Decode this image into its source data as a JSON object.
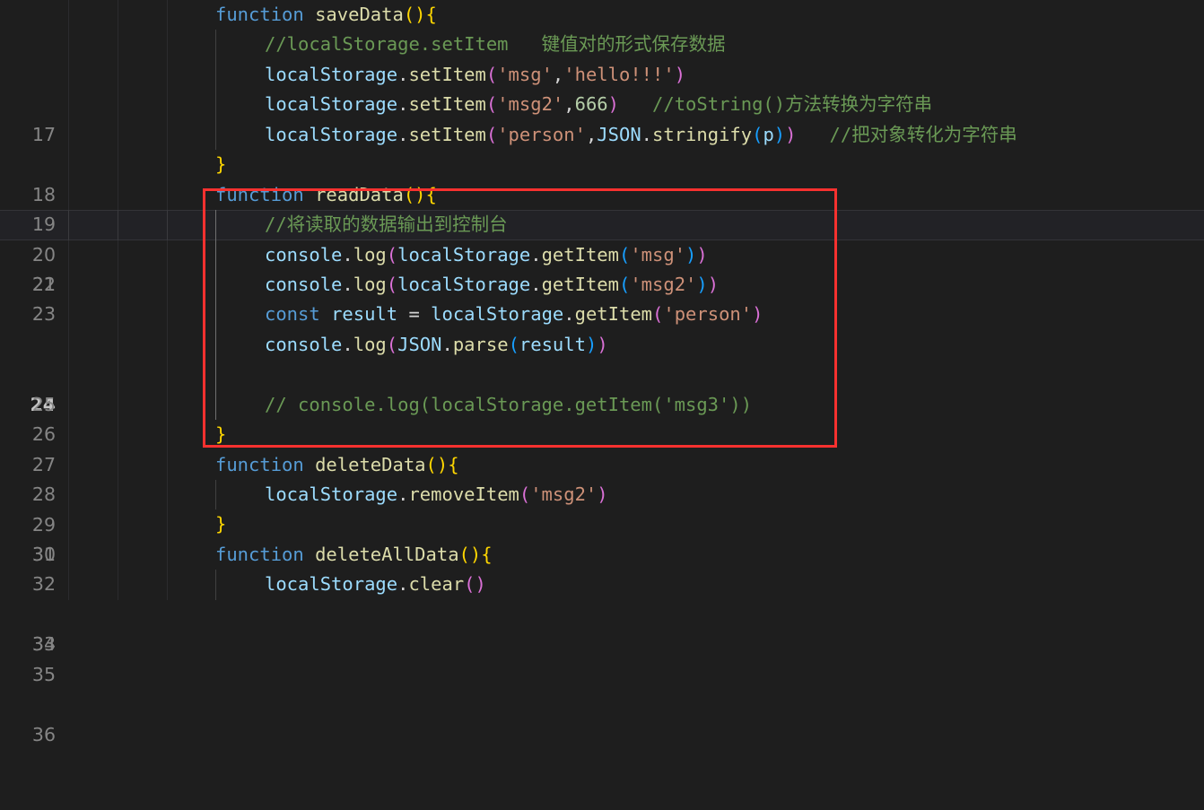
{
  "editor": {
    "background_color": "#1e1e1e",
    "active_line_number": 24,
    "first_visible_line": 17,
    "last_visible_line": 36
  },
  "annotation": {
    "name": "red-highlight-rectangle",
    "color": "#f8312f",
    "covers_lines": "23-31",
    "covers_function": "readData"
  },
  "lines": [
    {
      "num": "17",
      "indent": 0
    },
    {
      "num": "18",
      "indent": 1
    },
    {
      "num": "19",
      "indent": 1
    },
    {
      "num": "20",
      "indent": 1
    },
    {
      "num": "21",
      "indent": 1
    },
    {
      "num": "22",
      "indent": 0
    },
    {
      "num": "23",
      "indent": 0
    },
    {
      "num": "24",
      "indent": 1
    },
    {
      "num": "25",
      "indent": 1
    },
    {
      "num": "26",
      "indent": 1
    },
    {
      "num": "27",
      "indent": 1
    },
    {
      "num": "28",
      "indent": 1
    },
    {
      "num": "29",
      "indent": 1
    },
    {
      "num": "30",
      "indent": 1
    },
    {
      "num": "31",
      "indent": 0
    },
    {
      "num": "32",
      "indent": 0
    },
    {
      "num": "33",
      "indent": 1
    },
    {
      "num": "34",
      "indent": 0
    },
    {
      "num": "35",
      "indent": 0
    },
    {
      "num": "36",
      "indent": 1
    }
  ],
  "code": {
    "l17": {
      "kw": "function",
      "sp1": " ",
      "name": "saveData",
      "paren": "()",
      "brace": "{"
    },
    "l18": {
      "comment": "//localStorage.setItem",
      "gap": "   ",
      "cn": "键值对的形式保存数据"
    },
    "l19": {
      "obj": "localStorage",
      "dot": ".",
      "method": "setItem",
      "open": "(",
      "arg1": "'msg'",
      "comma": ",",
      "arg2": "'hello!!!'",
      "close": ")"
    },
    "l20": {
      "obj": "localStorage",
      "dot": ".",
      "method": "setItem",
      "open": "(",
      "arg1": "'msg2'",
      "comma": ",",
      "arg2": "666",
      "close": ")",
      "gap": "   ",
      "comment": "//toString()方法转换为字符串"
    },
    "l21": {
      "obj": "localStorage",
      "dot": ".",
      "method": "setItem",
      "open": "(",
      "arg1": "'person'",
      "comma": ",",
      "obj2": "JSON",
      "dot2": ".",
      "method2": "stringify",
      "open2": "(",
      "arg3": "p",
      "close2": ")",
      "close": ")",
      "gap": "   ",
      "comment": "//把对象转化为字符串"
    },
    "l22": {
      "brace": "}"
    },
    "l23": {
      "kw": "function",
      "sp1": " ",
      "name": "readData",
      "paren": "()",
      "brace": "{"
    },
    "l24": {
      "comment": "//将读取的数据输出到控制台"
    },
    "l25": {
      "obj": "console",
      "dot": ".",
      "method": "log",
      "open": "(",
      "obj2": "localStorage",
      "dot2": ".",
      "method2": "getItem",
      "open2": "(",
      "arg": "'msg'",
      "close2": ")",
      "close": ")"
    },
    "l26": {
      "obj": "console",
      "dot": ".",
      "method": "log",
      "open": "(",
      "obj2": "localStorage",
      "dot2": ".",
      "method2": "getItem",
      "open2": "(",
      "arg": "'msg2'",
      "close2": ")",
      "close": ")"
    },
    "l27": {
      "kw": "const",
      "sp1": " ",
      "varname": "result",
      "eq": " = ",
      "obj": "localStorage",
      "dot": ".",
      "method": "getItem",
      "open": "(",
      "arg": "'person'",
      "close": ")"
    },
    "l28": {
      "obj": "console",
      "dot": ".",
      "method": "log",
      "open": "(",
      "obj2": "JSON",
      "dot2": ".",
      "method2": "parse",
      "open2": "(",
      "arg": "result",
      "close2": ")",
      "close": ")"
    },
    "l29": {
      "empty": ""
    },
    "l30": {
      "comment": "// console.log(localStorage.getItem('msg3'))"
    },
    "l31": {
      "brace": "}"
    },
    "l32": {
      "kw": "function",
      "sp1": " ",
      "name": "deleteData",
      "paren": "()",
      "brace": "{"
    },
    "l33": {
      "obj": "localStorage",
      "dot": ".",
      "method": "removeItem",
      "open": "(",
      "arg": "'msg2'",
      "close": ")"
    },
    "l34": {
      "brace": "}"
    },
    "l35": {
      "kw": "function",
      "sp1": " ",
      "name": "deleteAllData",
      "paren": "()",
      "brace": "{"
    },
    "l36": {
      "obj": "localStorage",
      "dot": ".",
      "method": "clear",
      "open": "(",
      "close": ")"
    }
  },
  "colors": {
    "keyword": "#569cd6",
    "function_name": "#dcdcaa",
    "variable": "#9cdcfe",
    "string": "#ce9178",
    "number": "#b5cea8",
    "comment": "#6a9955",
    "bracket_1": "#da70d6",
    "bracket_2": "#179fff",
    "bracket_3": "#ffd700",
    "line_number": "#858585",
    "line_number_active": "#c6c6c6",
    "annotation": "#f8312f"
  }
}
